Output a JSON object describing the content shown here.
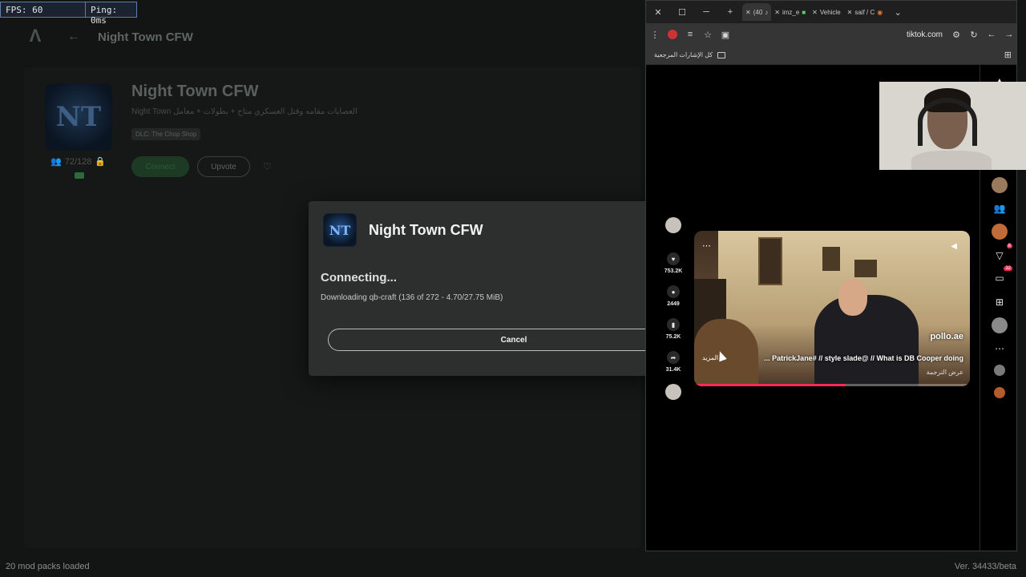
{
  "perf": {
    "fps": "FPS: 60",
    "ping": "Ping: 0ms"
  },
  "launcher": {
    "logo_glyph": "Λ",
    "back_glyph": "←",
    "header_title": "Night Town CFW",
    "server": {
      "logo_text": "NT",
      "players": "72/128",
      "name": "Night Town CFW",
      "subtitle": "Night Town العصابات مقامه وقتل العسكري متاح + بطولات + معامل",
      "dlc": "DLC: The Chop Shop",
      "connect_label": "Connect",
      "upvote_label": "Upvote"
    },
    "status_left": "20 mod packs loaded",
    "status_right": "Ver. 34433/beta"
  },
  "modal": {
    "logo_text": "NT",
    "title": "Night Town CFW",
    "status": "Connecting...",
    "progress": "Downloading qb-craft (136 of 272 - 4.70/27.75 MiB)",
    "cancel_label": "Cancel"
  },
  "browser": {
    "tabs": [
      {
        "label": "(40",
        "icon": "tiktok-icon",
        "active": true
      },
      {
        "label": "imz_e",
        "icon": "tab-icon",
        "active": false
      },
      {
        "label": "Vehicle",
        "icon": "tab-icon",
        "active": false
      },
      {
        "label": "saif / C",
        "icon": "tab-icon",
        "active": false
      }
    ],
    "url": "tiktok.com",
    "bookmarks_label": "كل الإشارات المرجعية"
  },
  "tiktok": {
    "likes": "753.2K",
    "comments": "2449",
    "saves": "75.2K",
    "shares": "31.4K",
    "handle": "pollo.ae",
    "caption": "... PatrickJane# // style slade@ // What is DB Cooper doing",
    "more": "المزيد",
    "translate": "عرض الترجمة",
    "inbox_badge": "32",
    "activity_badge": "8",
    "progress": 0.55
  }
}
